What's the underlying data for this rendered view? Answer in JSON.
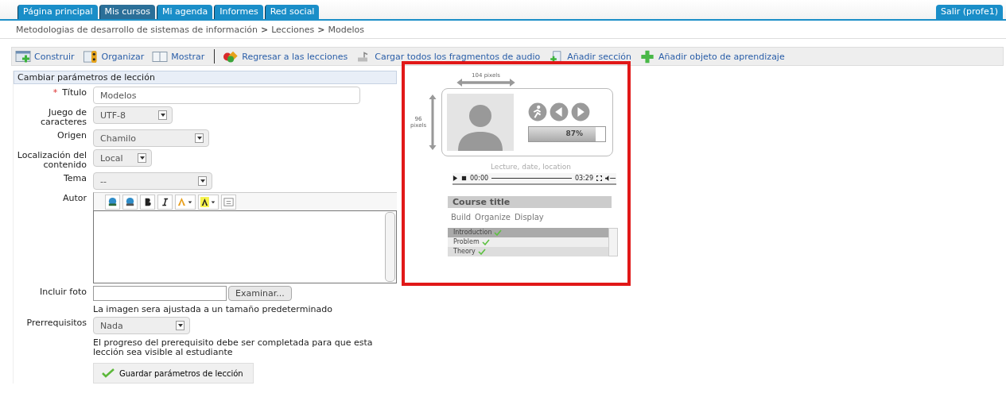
{
  "nav": {
    "tabs": [
      {
        "label": "Página principal",
        "selected": false
      },
      {
        "label": "Mis cursos",
        "selected": true
      },
      {
        "label": "Mi agenda",
        "selected": false
      },
      {
        "label": "Informes",
        "selected": false
      },
      {
        "label": "Red social",
        "selected": false
      }
    ],
    "logout": "Salir (profe1)"
  },
  "breadcrumb": {
    "separator": ">",
    "items": [
      "Metodologias de desarrollo de sistemas de información",
      "Lecciones",
      "Modelos"
    ]
  },
  "toolbar": [
    {
      "kind": "link",
      "label": "Construir"
    },
    {
      "kind": "link",
      "label": "Organizar"
    },
    {
      "kind": "link",
      "label": "Mostrar"
    },
    {
      "kind": "divider"
    },
    {
      "kind": "link",
      "label": "Regresar a las lecciones"
    },
    {
      "kind": "link",
      "label": "Cargar todos los fragmentos de audio"
    },
    {
      "kind": "link",
      "label": "Añadir sección"
    },
    {
      "kind": "link",
      "label": "Añadir objeto de aprendizaje"
    }
  ],
  "form": {
    "title": "Cambiar parámetros de lección",
    "fields": [
      {
        "kind": "text",
        "label": "Título",
        "required": true,
        "value": "Modelos"
      },
      {
        "kind": "select",
        "label": "Juego de caracteres",
        "required": false,
        "value": "UTF-8"
      },
      {
        "kind": "select",
        "label": "Origen",
        "required": false,
        "value": "Chamilo"
      },
      {
        "kind": "select",
        "label": "Localización del contenido",
        "required": false,
        "value": "Local"
      },
      {
        "kind": "select",
        "label": "Tema",
        "required": false,
        "value": "--"
      },
      {
        "kind": "editor",
        "label": "Autor",
        "required": false
      },
      {
        "kind": "file",
        "label": "Incluir foto",
        "required": false,
        "button": "Examinar...",
        "hint": "La imagen sera ajustada a un tamaño predeterminado"
      },
      {
        "kind": "select",
        "label": "Prerrequisitos",
        "required": false,
        "value": "Nada",
        "hint": "El progreso del prerequisito debe ser completada para que esta lección sea visible al estudiante"
      }
    ],
    "submit": "Guardar parámetros de lección",
    "required_mark": "*"
  },
  "preview": {
    "width_label": "104 pixels",
    "height_label": "96 pixels",
    "progress": {
      "level": 0.87,
      "reading": "87%"
    },
    "caption": "Lecture, date, location",
    "player": {
      "start": "00:00",
      "end": "03:29"
    },
    "course_title": "Course title",
    "menu": [
      "Build",
      "Organize",
      "Display"
    ],
    "items": [
      {
        "label": "Introduction",
        "selected": true,
        "done": true
      },
      {
        "label": "Problem",
        "selected": false,
        "done": true
      },
      {
        "label": "Theory",
        "selected": false,
        "done": true
      }
    ]
  }
}
